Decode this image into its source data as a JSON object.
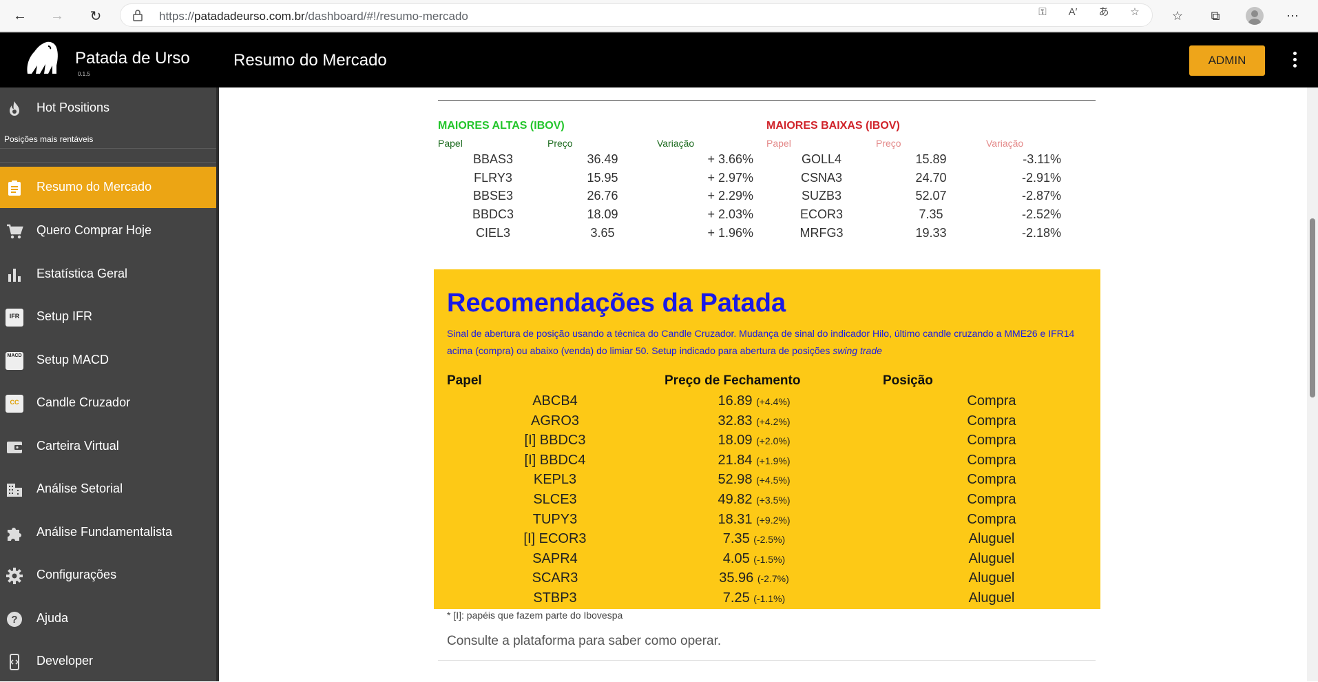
{
  "browser": {
    "url_prefix": "https://",
    "url_host": "patadadeurso.com.br",
    "url_path": "/dashboard/#!/resumo-mercado"
  },
  "header": {
    "brand": "Patada de Urso",
    "version": "0.1.5",
    "page_title": "Resumo do Mercado",
    "admin_label": "ADMIN"
  },
  "sidebar": {
    "hot": {
      "label": "Hot Positions",
      "sub": "Posições mais rentáveis"
    },
    "items": [
      {
        "label": "Resumo do Mercado",
        "icon": "clipboard-icon"
      },
      {
        "label": "Quero Comprar Hoje",
        "icon": "cart-icon"
      },
      {
        "label": "Estatística Geral",
        "icon": "bar-chart-icon"
      },
      {
        "label": "Setup IFR",
        "icon": "ifr-icon",
        "badge": "IFR"
      },
      {
        "label": "Setup MACD",
        "icon": "macd-icon",
        "badge": "MACD"
      },
      {
        "label": "Candle Cruzador",
        "icon": "cc-icon",
        "badge": "CC"
      },
      {
        "label": "Carteira Virtual",
        "icon": "wallet-icon"
      },
      {
        "label": "Análise Setorial",
        "icon": "building-icon"
      },
      {
        "label": "Análise Fundamentalista",
        "icon": "puzzle-icon"
      },
      {
        "label": "Configurações",
        "icon": "gear-icon"
      },
      {
        "label": "Ajuda",
        "icon": "help-icon"
      },
      {
        "label": "Developer",
        "icon": "developer-icon"
      }
    ]
  },
  "highs": {
    "title": "MAIORES ALTAS (IBOV)",
    "headers": [
      "Papel",
      "Preço",
      "Variação"
    ],
    "rows": [
      [
        "BBAS3",
        "36.49",
        "+ 3.66%"
      ],
      [
        "FLRY3",
        "15.95",
        "+ 2.97%"
      ],
      [
        "BBSE3",
        "26.76",
        "+ 2.29%"
      ],
      [
        "BBDC3",
        "18.09",
        "+ 2.03%"
      ],
      [
        "CIEL3",
        "3.65",
        "+ 1.96%"
      ]
    ]
  },
  "lows": {
    "title": "MAIORES BAIXAS (IBOV)",
    "headers": [
      "Papel",
      "Preço",
      "Variação"
    ],
    "rows": [
      [
        "GOLL4",
        "15.89",
        "-3.11%"
      ],
      [
        "CSNA3",
        "24.70",
        "-2.91%"
      ],
      [
        "SUZB3",
        "52.07",
        "-2.87%"
      ],
      [
        "ECOR3",
        "7.35",
        "-2.52%"
      ],
      [
        "MRFG3",
        "19.33",
        "-2.18%"
      ]
    ]
  },
  "recs": {
    "title": "Recomendações da Patada",
    "desc_main": "Sinal de abertura de posição usando a técnica do Candle Cruzador. Mudança de sinal do indicador Hilo, último candle cruzando a MME26 e IFR14 acima (compra) ou abaixo (venda) do limiar 50. Setup indicado para abertura de posições ",
    "desc_em": "swing trade",
    "headers": [
      "Papel",
      "Preço de Fechamento",
      "Posição"
    ],
    "rows": [
      [
        "ABCB4",
        "16.89",
        "(+4.4%)",
        "Compra"
      ],
      [
        "AGRO3",
        "32.83",
        "(+4.2%)",
        "Compra"
      ],
      [
        "[I] BBDC3",
        "18.09",
        "(+2.0%)",
        "Compra"
      ],
      [
        "[I] BBDC4",
        "21.84",
        "(+1.9%)",
        "Compra"
      ],
      [
        "KEPL3",
        "52.98",
        "(+4.5%)",
        "Compra"
      ],
      [
        "SLCE3",
        "49.82",
        "(+3.5%)",
        "Compra"
      ],
      [
        "TUPY3",
        "18.31",
        "(+9.2%)",
        "Compra"
      ],
      [
        "[I] ECOR3",
        "7.35",
        "(-2.5%)",
        "Aluguel"
      ],
      [
        "SAPR4",
        "4.05",
        "(-1.5%)",
        "Aluguel"
      ],
      [
        "SCAR3",
        "35.96",
        "(-2.7%)",
        "Aluguel"
      ],
      [
        "STBP3",
        "7.25",
        "(-1.1%)",
        "Aluguel"
      ]
    ],
    "note": "* [I]: papéis que fazem parte do Ibovespa",
    "consult": "Consulte a plataforma para saber como operar."
  },
  "colors": {
    "accent": "#eca514",
    "highs": "#22c52a",
    "lows": "#d0232a",
    "rec_bg": "#fdc916",
    "rec_title": "#1a1ae6"
  }
}
